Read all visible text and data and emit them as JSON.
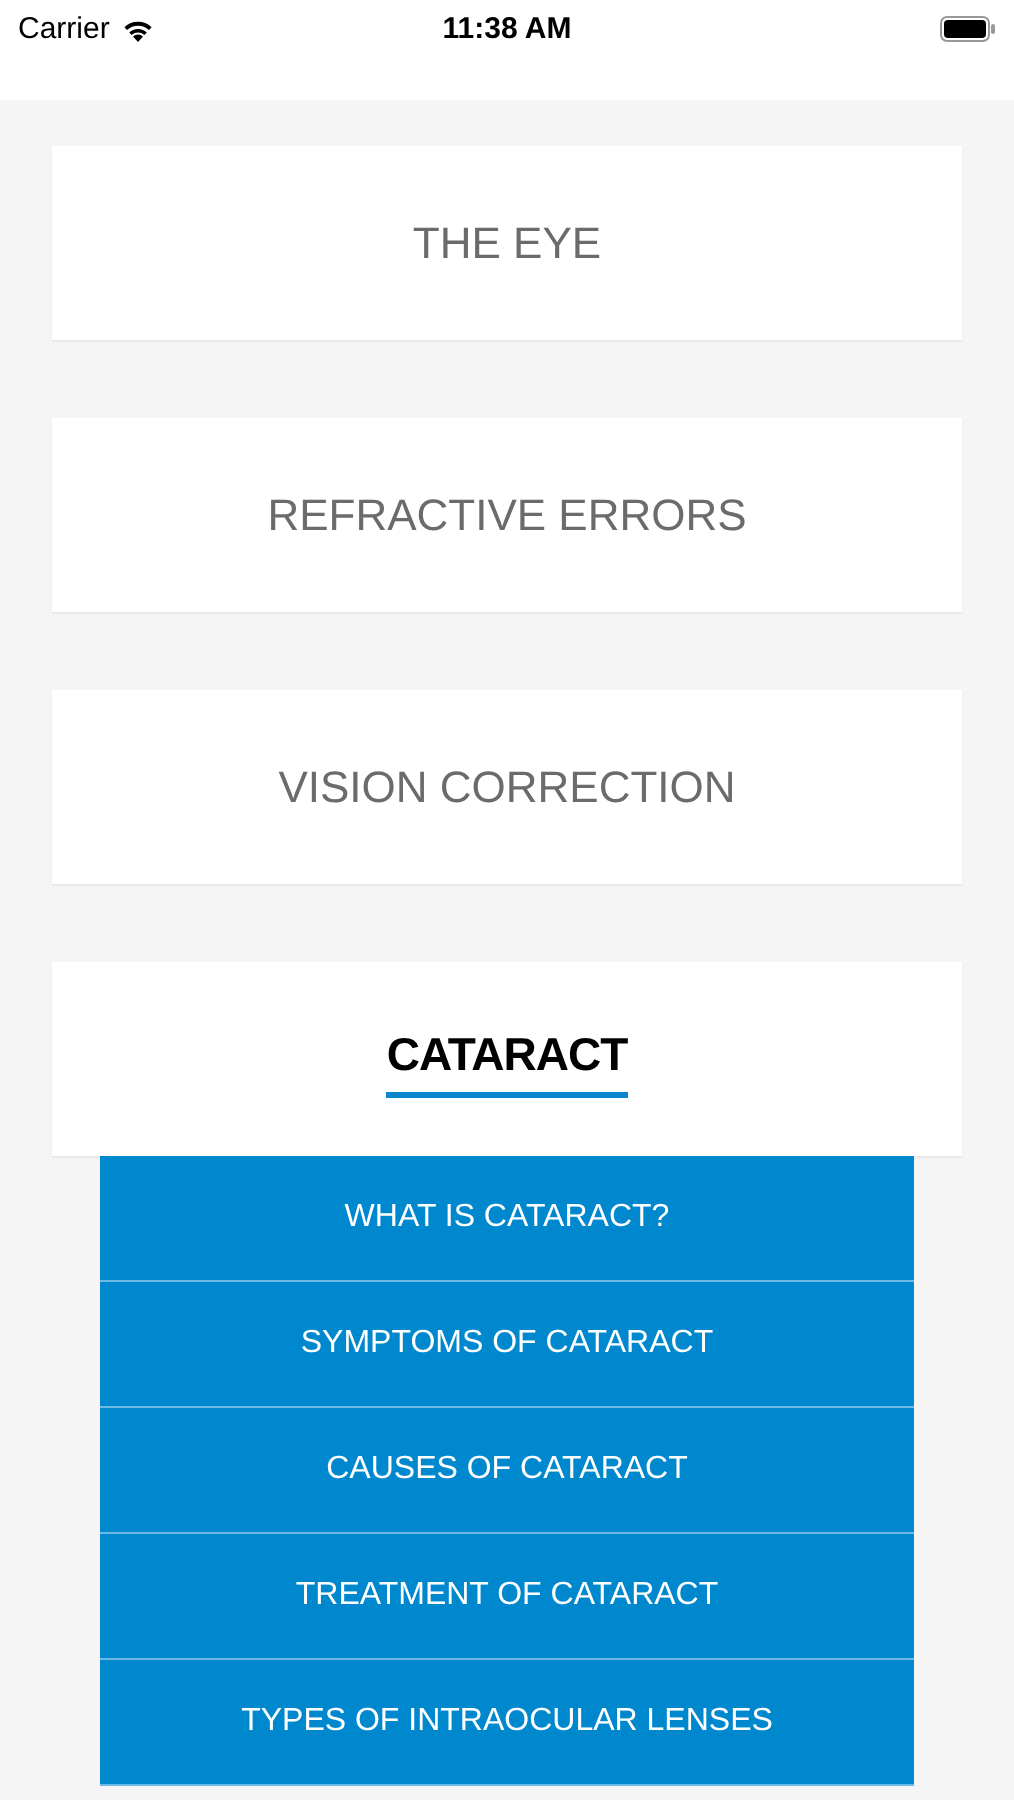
{
  "status_bar": {
    "carrier": "Carrier",
    "time": "11:38 AM"
  },
  "sections": [
    {
      "label": "THE EYE",
      "expanded": false
    },
    {
      "label": "REFRACTIVE ERRORS",
      "expanded": false
    },
    {
      "label": "VISION CORRECTION",
      "expanded": false
    },
    {
      "label": "CATARACT",
      "expanded": true,
      "items": [
        "WHAT IS CATARACT?",
        "SYMPTOMS OF CATARACT",
        "CAUSES OF CATARACT",
        "TREATMENT OF CATARACT",
        "TYPES OF INTRAOCULAR LENSES"
      ]
    }
  ]
}
